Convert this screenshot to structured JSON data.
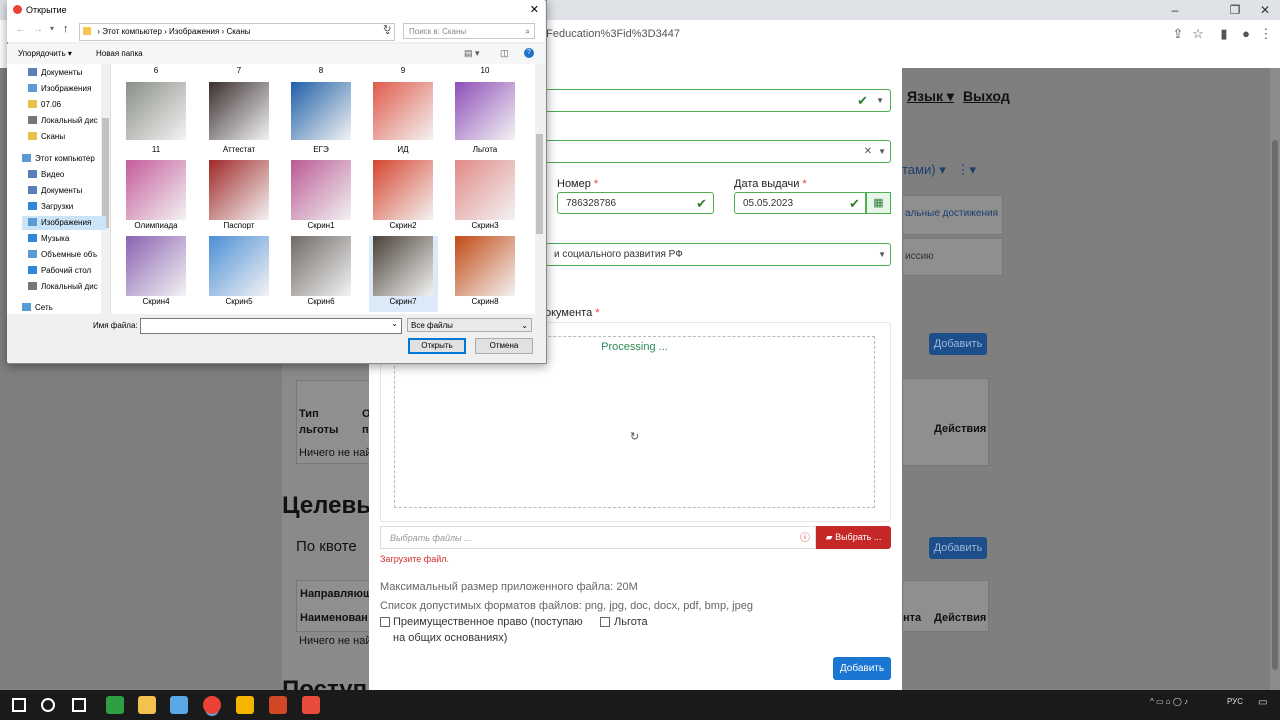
{
  "browser": {
    "url_fragment": "2Feducation%3Fid%3D3447",
    "win_minimize": "–",
    "win_restore": "❐",
    "win_close": "✕"
  },
  "background_page": {
    "nav_language": "Язык",
    "nav_exit": "Выход",
    "tab_partial": "тами)",
    "side_btn1": "альные достижения",
    "side_btn2": "иссию",
    "add_btn_1": "Добавить",
    "add_btn_2": "Добавить",
    "table1_col1": "Тип\nльготы",
    "table1_col2": "О\nпр",
    "table1_actions": "Действия",
    "table1_empty": "Ничего не най",
    "heading_target": "Целевь",
    "quota_label": "По квоте",
    "table2_col1": "Направляющ",
    "table2_col2": "Наименован",
    "table2_col3": "нта",
    "table2_actions": "Действия",
    "table2_empty": "Ничего не най",
    "bottom_heading": "Поступление на основании"
  },
  "modal": {
    "number_label": "Номер",
    "number_value": "786328786",
    "issue_date_label": "Дата выдачи",
    "issue_date_value": "05.05.2023",
    "org_value": "и социального развития РФ",
    "document_label": "окумента",
    "required_mark": "*",
    "processing_text": "Processing ...",
    "file_placeholder": "Выбрать файлы ...",
    "choose_button": "Выбрать ...",
    "upload_error": "Загрузите файл.",
    "max_size": "Максимальный размер приложенного файла: 20M",
    "formats": "Список допустимых форматов файлов: png, jpg, doc, docx, pdf, bmp, jpeg",
    "checkbox_priority": "Преимущественное право (поступаю на общих основаниях)",
    "checkbox_priority_line1": "Преимущественное право (поступаю",
    "checkbox_priority_line2": "на общих основаниях)",
    "checkbox_benefit": "Льгота",
    "add_button": "Добавить"
  },
  "dialog": {
    "title": "Открытие",
    "breadcrumb": [
      "Этот компьютер",
      "Изображения",
      "Сканы"
    ],
    "search_placeholder": "Поиск в: Сканы",
    "organize": "Упорядочить",
    "new_folder": "Новая папка",
    "nav_items": [
      {
        "label": "Документы",
        "color": "#5b7fb8"
      },
      {
        "label": "Изображения",
        "color": "#5b9bd5"
      },
      {
        "label": "07.06",
        "color": "#e8c14d"
      },
      {
        "label": "Локальный дис",
        "color": "#777777"
      },
      {
        "label": "Сканы",
        "color": "#e8c14d"
      },
      {
        "label": "Этот компьютер",
        "color": "#5b9bd5"
      },
      {
        "label": "Видео",
        "color": "#5b7fb8"
      },
      {
        "label": "Документы",
        "color": "#5b7fb8"
      },
      {
        "label": "Загрузки",
        "color": "#2e86de"
      },
      {
        "label": "Изображения",
        "color": "#5b9bd5"
      },
      {
        "label": "Музыка",
        "color": "#2e86de"
      },
      {
        "label": "Объемные объ",
        "color": "#5b9bd5"
      },
      {
        "label": "Рабочий стол",
        "color": "#2e86de"
      },
      {
        "label": "Локальный дис",
        "color": "#777777"
      },
      {
        "label": "Сеть",
        "color": "#5b9bd5"
      }
    ],
    "top_numbers": [
      "6",
      "7",
      "8",
      "9",
      "10"
    ],
    "files": [
      {
        "name": "11",
        "color": "#8a8f87"
      },
      {
        "name": "Аттестат",
        "color": "#3b2f2f"
      },
      {
        "name": "ЕГЭ",
        "color": "#1f5fa8"
      },
      {
        "name": "ИД",
        "color": "#e05b4c"
      },
      {
        "name": "Льгота",
        "color": "#8e4fb8"
      },
      {
        "name": "Олимпиада",
        "color": "#c45c9a"
      },
      {
        "name": "Паспорт",
        "color": "#a02828"
      },
      {
        "name": "Скрин1",
        "color": "#b95a93"
      },
      {
        "name": "Скрин2",
        "color": "#d6452f"
      },
      {
        "name": "Скрин3",
        "color": "#e18a86"
      },
      {
        "name": "Скрин4",
        "color": "#8a62b3"
      },
      {
        "name": "Скрин5",
        "color": "#4b8fd6"
      },
      {
        "name": "Скрин6",
        "color": "#6f6a66"
      },
      {
        "name": "Скрин7",
        "color": "#4a4238"
      },
      {
        "name": "Скрин8",
        "color": "#c04a14"
      }
    ],
    "filename_label": "Имя файла:",
    "filetype_value": "Все файлы",
    "open_button": "Открыть",
    "cancel_button": "Отмена"
  },
  "taskbar": {
    "language": "РУС",
    "apps": [
      {
        "name": "windows-start",
        "color": "#ffffff"
      },
      {
        "name": "search",
        "color": "#ffffff"
      },
      {
        "name": "task-view",
        "color": "#ffffff"
      },
      {
        "name": "app-green",
        "color": "#2ea043"
      },
      {
        "name": "explorer",
        "color": "#f2c14e"
      },
      {
        "name": "app-blue",
        "color": "#5aa9e6"
      },
      {
        "name": "chrome",
        "color": "#ea4335"
      },
      {
        "name": "app-1c",
        "color": "#f4b400"
      },
      {
        "name": "powerpoint",
        "color": "#d24726"
      },
      {
        "name": "app-red",
        "color": "#e74c3c"
      }
    ]
  }
}
